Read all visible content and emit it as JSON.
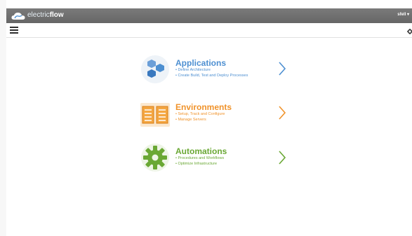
{
  "brand": {
    "prefix": "electric",
    "suffix": "flow"
  },
  "user": {
    "name": "sfell"
  },
  "icons": {
    "logo": "cloud-logo-icon",
    "menu": "hamburger-menu-icon",
    "settings": "gear-icon",
    "chevron": "chevron-right-icon"
  },
  "colors": {
    "applications": "#4d8fd1",
    "environments": "#f0932b",
    "automations": "#6aa834",
    "topbar": "#6e6e6e"
  },
  "items": [
    {
      "title": "Applications",
      "bullets": [
        "• Define Architecture",
        "• Create Build, Test and Deploy Processes"
      ]
    },
    {
      "title": "Environments",
      "bullets": [
        "• Setup, Track and Configure",
        "• Manage Servers"
      ]
    },
    {
      "title": "Automations",
      "bullets": [
        "• Procedures and Workflows",
        "• Optimize Infrastructure"
      ]
    }
  ]
}
